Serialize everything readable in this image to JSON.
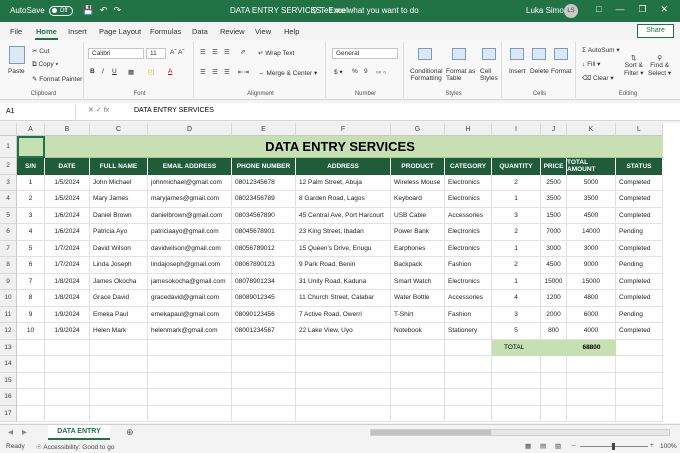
{
  "titlebar": {
    "autosave": "AutoSave",
    "toggle": "Off",
    "title": "DATA ENTRY SERVICES  -  Excel",
    "search": "Tell me what you want to do",
    "user": "Luka Simon",
    "initials": "LS"
  },
  "menu": {
    "tabs": [
      "File",
      "Home",
      "Insert",
      "Page Layout",
      "Formulas",
      "Data",
      "Review",
      "View",
      "Help"
    ],
    "share": "Share"
  },
  "ribbon": {
    "paste": "Paste",
    "cut": "Cut",
    "copy": "Copy",
    "format_painter": "Format Painter",
    "clipboard": "Clipboard",
    "font_name": "Calibri",
    "font_size": "11",
    "font": "Font",
    "wrap_text": "Wrap Text",
    "merge_center": "Merge & Center",
    "alignment": "Alignment",
    "number_format": "General",
    "number": "Number",
    "conditional_formatting_1": "Conditional",
    "conditional_formatting_2": "Formatting",
    "format_as_table_1": "Format as",
    "format_as_table_2": "Table",
    "cell_styles_1": "Cell",
    "cell_styles_2": "Styles",
    "styles": "Styles",
    "insert": "Insert",
    "delete": "Delete",
    "format": "Format",
    "cells": "Cells",
    "autosum": "AutoSum",
    "fill": "Fill",
    "clear": "Clear",
    "sort_filter_1": "Sort &",
    "sort_filter_2": "Filter",
    "find_select_1": "Find &",
    "find_select_2": "Select",
    "editing": "Editing"
  },
  "formula_bar": {
    "name_box": "A1",
    "fx": "fx",
    "value": "DATA ENTRY SERVICES"
  },
  "sheet": {
    "columns": [
      "A",
      "B",
      "C",
      "D",
      "E",
      "F",
      "G",
      "H",
      "I",
      "J",
      "K",
      "L"
    ],
    "row_numbers": [
      "1",
      "2",
      "3",
      "4",
      "5",
      "6",
      "7",
      "8",
      "9",
      "10",
      "11",
      "12",
      "13",
      "14",
      "15",
      "16",
      "17"
    ],
    "title": "DATA ENTRY SERVICES",
    "headers": [
      "S/N",
      "DATE",
      "FULL NAME",
      "EMAIL ADDRESS",
      "PHONE NUMBER",
      "ADDRESS",
      "PRODUCT",
      "CATEGORY",
      "QUANTITY",
      "PRICE",
      "TOTAL AMOUNT",
      "STATUS"
    ],
    "rows": [
      [
        "1",
        "1/5/2024",
        "John Michael",
        "johnmichael@gmail.com",
        "08012345678",
        "12 Palm Street, Abuja",
        "Wireless Mouse",
        "Electronics",
        "2",
        "2500",
        "5000",
        "Completed"
      ],
      [
        "2",
        "1/5/2024",
        "Mary James",
        "maryjames@gmail.com",
        "08023456789",
        "8 Garden Road, Lagos",
        "Keyboard",
        "Electronics",
        "1",
        "3500",
        "3500",
        "Completed"
      ],
      [
        "3",
        "1/6/2024",
        "Daniel Brown",
        "danielbrown@gmail.com",
        "08034567890",
        "45 Central Ave, Port Harcourt",
        "USB Cable",
        "Accessories",
        "3",
        "1500",
        "4500",
        "Completed"
      ],
      [
        "4",
        "1/6/2024",
        "Patricia Ayo",
        "patriciaayo@gmail.com",
        "08045678901",
        "23 King Street, Ibadan",
        "Power Bank",
        "Electronics",
        "2",
        "7000",
        "14000",
        "Pending"
      ],
      [
        "5",
        "1/7/2024",
        "David Wilson",
        "davidwilson@gmail.com",
        "08056789012",
        "15 Queen's Drive, Enugu",
        "Earphones",
        "Electronics",
        "1",
        "3000",
        "3000",
        "Completed"
      ],
      [
        "6",
        "1/7/2024",
        "Linda Joseph",
        "lindajoseph@gmail.com",
        "08067890123",
        "9 Park Road, Benin",
        "Backpack",
        "Fashion",
        "2",
        "4500",
        "9000",
        "Pending"
      ],
      [
        "7",
        "1/8/2024",
        "James Okocha",
        "jamesokocha@gmail.com",
        "08078901234",
        "31 Unity Road, Kaduna",
        "Smart Watch",
        "Electronics",
        "1",
        "15000",
        "15000",
        "Completed"
      ],
      [
        "8",
        "1/8/2024",
        "Grace David",
        "gracedavid@gmail.com",
        "08089012345",
        "11 Church Street, Calabar",
        "Water Bottle",
        "Accessories",
        "4",
        "1200",
        "4800",
        "Completed"
      ],
      [
        "9",
        "1/9/2024",
        "Emeka Paul",
        "emekapaul@gmail.com",
        "08090123456",
        "7 Active Road, Owerri",
        "T-Shirt",
        "Fashion",
        "3",
        "2000",
        "6000",
        "Pending"
      ],
      [
        "10",
        "1/9/2024",
        "Helen Mark",
        "helenmark@gmail.com",
        "08001234567",
        "22 Lake View, Uyo",
        "Notebook",
        "Stationery",
        "5",
        "800",
        "4000",
        "Completed"
      ]
    ],
    "total_label": "TOTAL",
    "total_value": "68800"
  },
  "sheet_tab": "DATA ENTRY",
  "status": {
    "ready": "Ready",
    "accessibility": "Accessibility: Good to go",
    "zoom": "100%"
  },
  "colors": {
    "excel_green": "#217346",
    "header_green": "#1f5c3a",
    "light_green": "#c6e0b4"
  }
}
